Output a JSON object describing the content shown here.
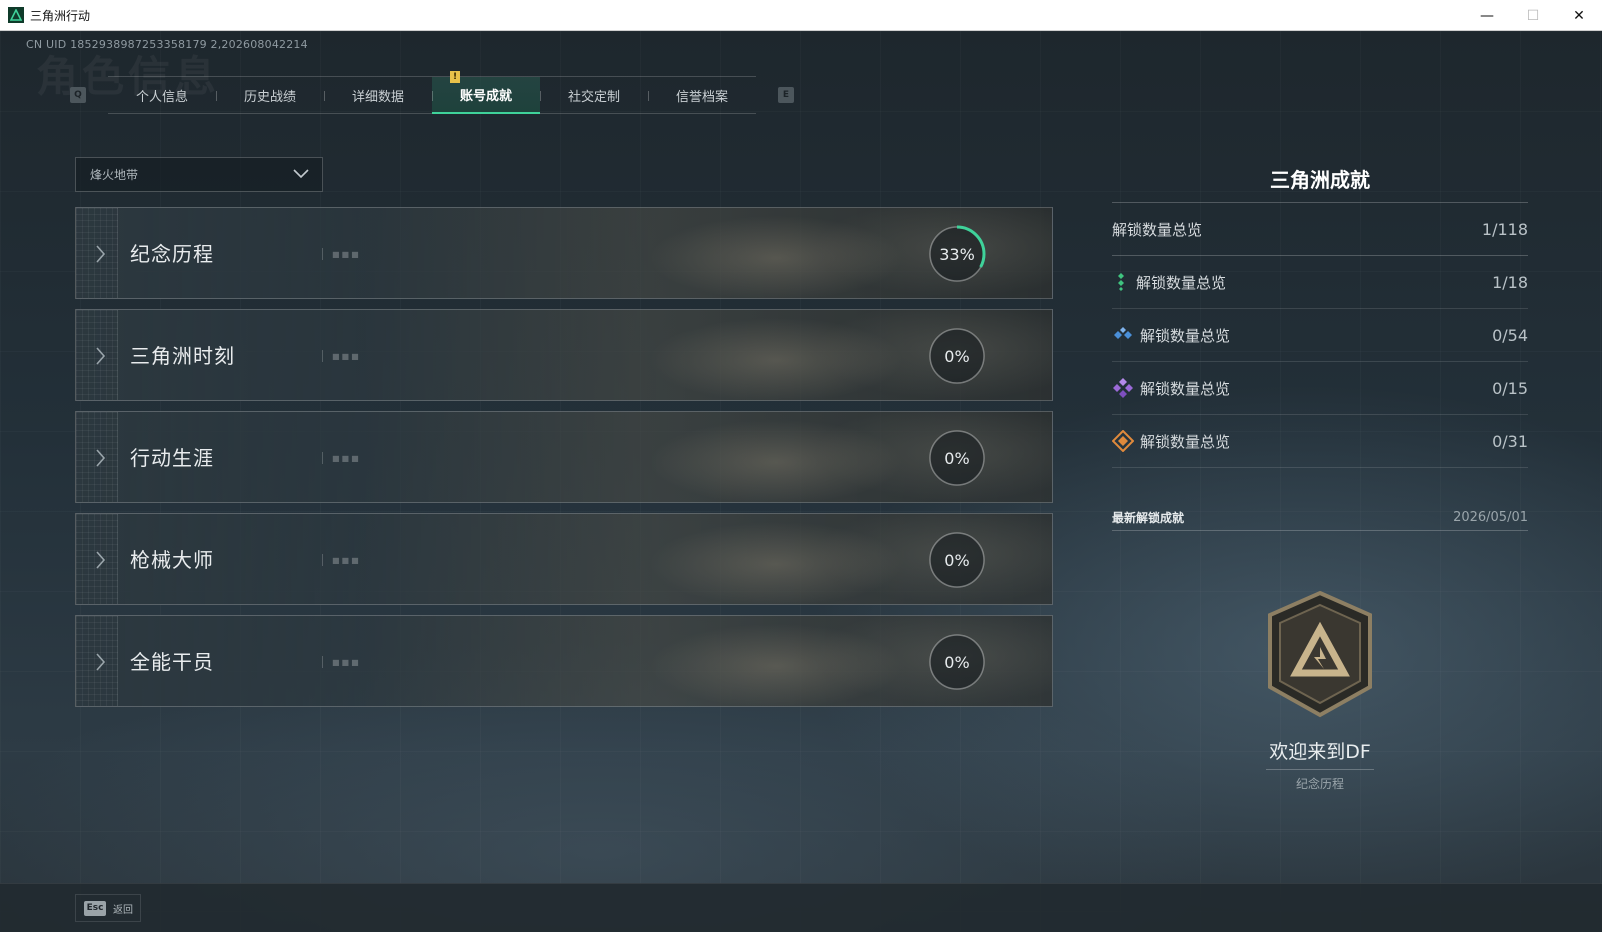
{
  "window": {
    "title": "三角洲行动",
    "min": "—",
    "max": "☐",
    "close": "✕"
  },
  "uid": "CN UID 1852938987253358179 2,202608042214",
  "background_title": "角色信息",
  "tabs": {
    "prev_key": "Q",
    "next_key": "E",
    "marker": "!",
    "items": [
      {
        "label": "个人信息"
      },
      {
        "label": "历史战绩"
      },
      {
        "label": "详细数据"
      },
      {
        "label": "账号成就",
        "active": true
      },
      {
        "label": "社交定制"
      },
      {
        "label": "信誉档案"
      }
    ]
  },
  "dropdown": {
    "value": "烽火地带"
  },
  "categories": [
    {
      "name": "纪念历程",
      "percent_label": "33%",
      "progress": 0.33
    },
    {
      "name": "三角洲时刻",
      "percent_label": "0%",
      "progress": 0
    },
    {
      "name": "行动生涯",
      "percent_label": "0%",
      "progress": 0
    },
    {
      "name": "枪械大师",
      "percent_label": "0%",
      "progress": 0
    },
    {
      "name": "全能干员",
      "percent_label": "0%",
      "progress": 0
    }
  ],
  "panel": {
    "title": "三角洲成就",
    "total": {
      "label": "解锁数量总览",
      "value": "1/118"
    },
    "tiers": [
      {
        "label": "解锁数量总览",
        "value": "1/18",
        "color": "#3fc47f",
        "icon": "green-tier-icon"
      },
      {
        "label": "解锁数量总览",
        "value": "0/54",
        "color": "#4a8fd8",
        "icon": "blue-tier-icon"
      },
      {
        "label": "解锁数量总览",
        "value": "0/15",
        "color": "#9b6ad8",
        "icon": "purple-tier-icon"
      },
      {
        "label": "解锁数量总览",
        "value": "0/31",
        "color": "#e08a3c",
        "icon": "orange-tier-icon"
      }
    ]
  },
  "latest": {
    "label": "最新解锁成就",
    "date": "2026/05/01",
    "achievement_name": "欢迎来到DF",
    "achievement_category": "纪念历程"
  },
  "bottom": {
    "esc_key": "Esc",
    "back_label": "返回"
  },
  "colors": {
    "accent": "#3fd29a",
    "tab_marker": "#e9c24a"
  }
}
